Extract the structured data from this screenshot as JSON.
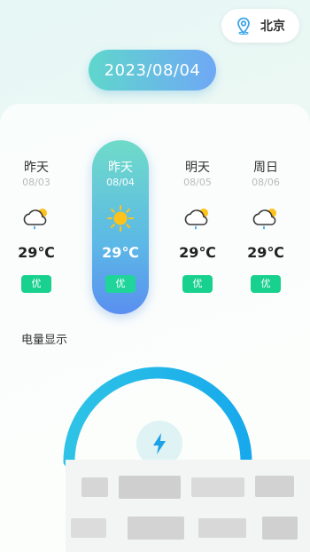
{
  "location": {
    "city": "北京",
    "icon": "location-pin-icon"
  },
  "date": "2023/08/04",
  "days": [
    {
      "name": "昨天",
      "date": "08/03",
      "icon": "cloudy-rain-icon",
      "temp": "29℃",
      "aqi": "优"
    },
    {
      "name": "昨天",
      "date": "08/04",
      "icon": "sunny-icon",
      "temp": "29℃",
      "aqi": "优"
    },
    {
      "name": "明天",
      "date": "08/05",
      "icon": "cloudy-rain-icon",
      "temp": "29℃",
      "aqi": "优"
    },
    {
      "name": "周日",
      "date": "08/06",
      "icon": "cloudy-rain-icon",
      "temp": "29℃",
      "aqi": "优"
    }
  ],
  "battery": {
    "title": "电量显示",
    "icon": "lightning-icon"
  },
  "colors": {
    "accent": "#1cb8e8",
    "aqi_good": "#19d18e",
    "sun": "#ffc21a"
  }
}
